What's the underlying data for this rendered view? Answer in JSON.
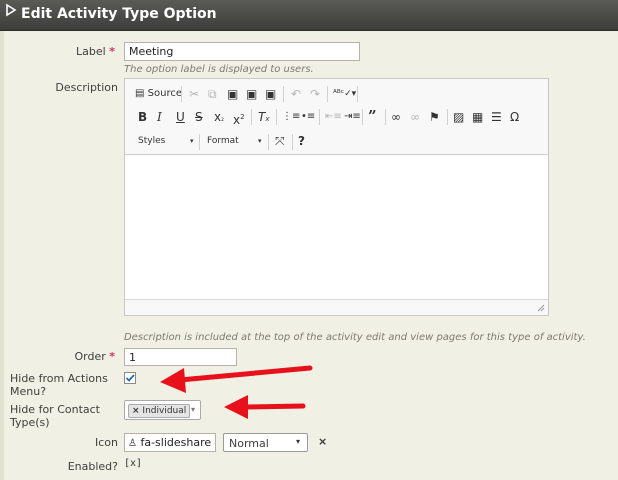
{
  "header": {
    "title": "Edit Activity Type Option"
  },
  "form": {
    "label": {
      "label": "Label",
      "required_mark": "*",
      "value": "Meeting",
      "help": "The option label is displayed to users."
    },
    "description": {
      "label": "Description",
      "help": "Description is included at the top of the activity edit and view pages for this type of activity."
    },
    "editor": {
      "source_label": "Source",
      "styles_label": "Styles",
      "format_label": "Format",
      "icons": [
        "source-icon",
        "cut-icon",
        "copy-icon",
        "paste-icon",
        "paste-text-icon",
        "paste-word-icon",
        "undo-icon",
        "redo-icon",
        "spellcheck-icon",
        "bold-icon",
        "italic-icon",
        "underline-icon",
        "strikethrough-icon",
        "subscript-icon",
        "superscript-icon",
        "remove-format-icon",
        "numbered-list-icon",
        "bulleted-list-icon",
        "outdent-icon",
        "indent-icon",
        "blockquote-icon",
        "link-icon",
        "unlink-icon",
        "anchor-icon",
        "image-icon",
        "table-icon",
        "horizontal-line-icon",
        "special-char-icon",
        "maximize-icon",
        "help-icon"
      ]
    },
    "order": {
      "label": "Order",
      "required_mark": "*",
      "value": "1"
    },
    "hide_actions": {
      "label_line1": "Hide from Actions",
      "label_line2": "Menu?",
      "checked": true
    },
    "hide_contact": {
      "label_line1": "Hide for Contact",
      "label_line2": "Type(s)",
      "tag": "Individual"
    },
    "icon": {
      "label": "Icon",
      "value": "fa-slideshare",
      "style_value": "Normal"
    },
    "enabled": {
      "label": "Enabled?",
      "value": "[x]"
    }
  },
  "colors": {
    "arrow": "#e8111b",
    "required": "#cf3458",
    "header_bg": "#4a4a46",
    "panel_bg": "#f1f0e4"
  }
}
